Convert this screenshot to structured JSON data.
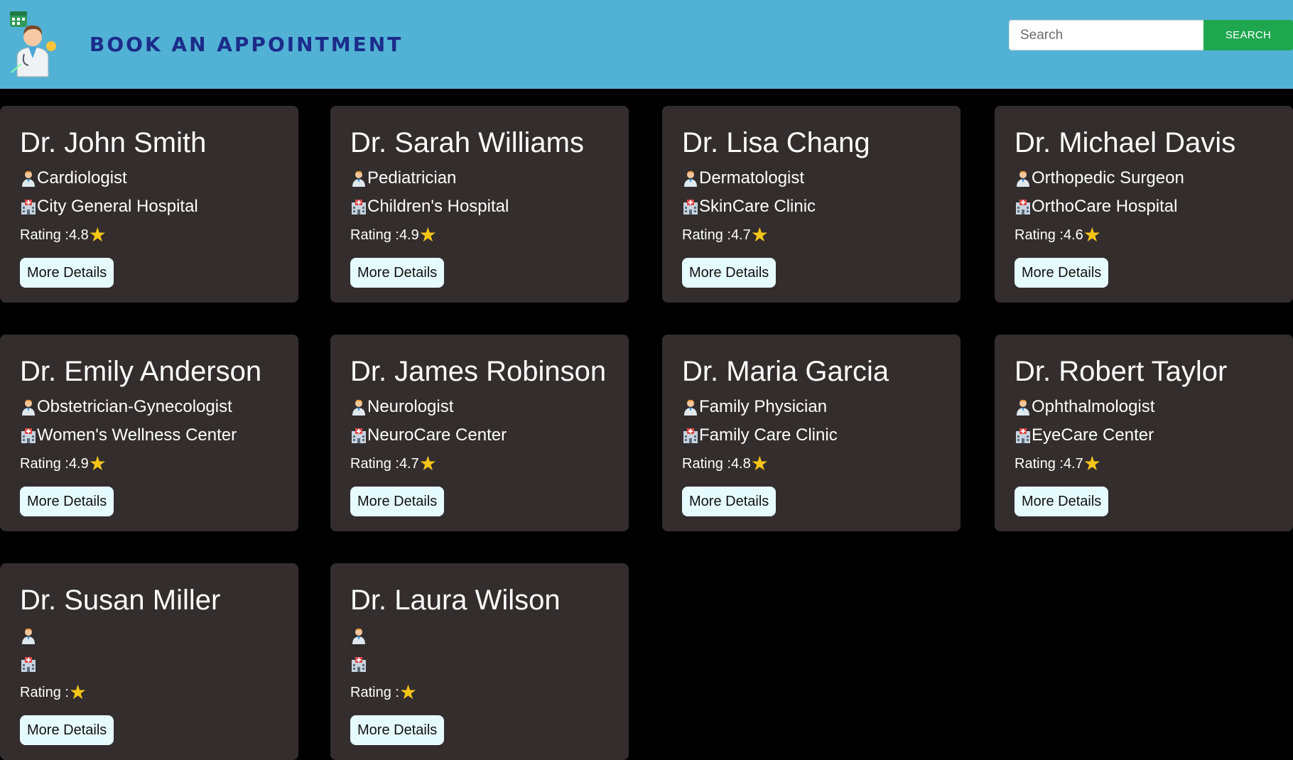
{
  "header": {
    "brand": "BOOK AN APPOINTMENT",
    "search_placeholder": "Search",
    "search_button": "SEARCH",
    "colors": {
      "background": "#52b2d5",
      "brand": "#1b2c8a",
      "search_button": "#1fa74f"
    }
  },
  "labels": {
    "rating_prefix": "Rating : ",
    "details_button": "More Details"
  },
  "doctors": [
    {
      "name": "Dr. John Smith",
      "specialty": "Cardiologist",
      "hospital": "City General Hospital",
      "rating": "4.8"
    },
    {
      "name": "Dr. Sarah Williams",
      "specialty": "Pediatrician",
      "hospital": "Children's Hospital",
      "rating": "4.9"
    },
    {
      "name": "Dr. Lisa Chang",
      "specialty": "Dermatologist",
      "hospital": "SkinCare Clinic",
      "rating": "4.7"
    },
    {
      "name": "Dr. Michael Davis",
      "specialty": "Orthopedic Surgeon",
      "hospital": "OrthoCare Hospital",
      "rating": "4.6"
    },
    {
      "name": "Dr. Emily Anderson",
      "specialty": "Obstetrician-Gynecologist",
      "hospital": "Women's Wellness Center",
      "rating": "4.9"
    },
    {
      "name": "Dr. James Robinson",
      "specialty": "Neurologist",
      "hospital": "NeuroCare Center",
      "rating": "4.7"
    },
    {
      "name": "Dr. Maria Garcia",
      "specialty": "Family Physician",
      "hospital": "Family Care Clinic",
      "rating": "4.8"
    },
    {
      "name": "Dr. Robert Taylor",
      "specialty": "Ophthalmologist",
      "hospital": "EyeCare Center",
      "rating": "4.7"
    },
    {
      "name": "Dr. Susan Miller",
      "specialty": "",
      "hospital": "",
      "rating": ""
    },
    {
      "name": "Dr. Laura Wilson",
      "specialty": "",
      "hospital": "",
      "rating": ""
    }
  ],
  "icons": {
    "specialty": "doctor-icon",
    "hospital": "hospital-icon",
    "rating": "star-icon"
  }
}
